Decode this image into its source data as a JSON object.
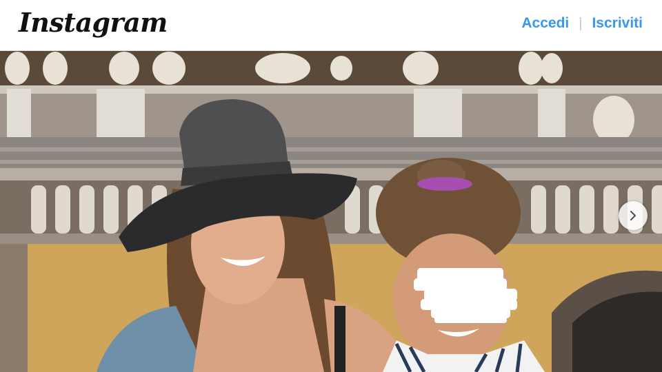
{
  "header": {
    "logo_text": "Instagram",
    "login_label": "Accedi",
    "separator": "|",
    "signup_label": "Iscriviti"
  },
  "post": {
    "carousel_next_icon": "chevron-right-icon"
  },
  "colors": {
    "link_blue": "#3897f0",
    "header_bg": "#ffffff"
  }
}
